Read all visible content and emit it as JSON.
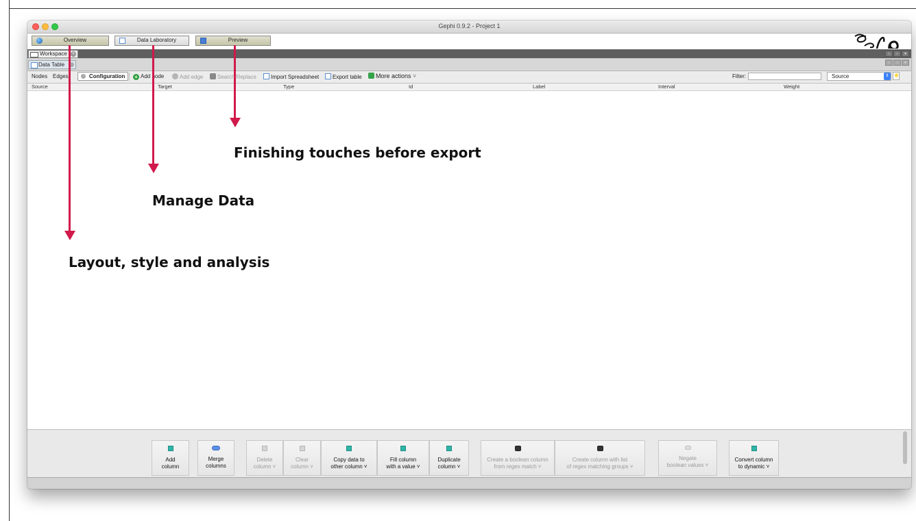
{
  "window": {
    "title": "Gephi 0.9.2 - Project 1"
  },
  "main_tabs": [
    {
      "label": "Overview",
      "icon": "globe-icon"
    },
    {
      "label": "Data Laboratory",
      "icon": "table-grid-icon"
    },
    {
      "label": "Preview",
      "icon": "monitor-icon"
    }
  ],
  "workspace": {
    "tab_label": "Workspace 1"
  },
  "data_table": {
    "tab_label": "Data Table"
  },
  "toolbar": {
    "nodes": "Nodes",
    "edges": "Edges",
    "configuration": "Configuration",
    "add_node": "Add node",
    "add_edge": "Add edge",
    "search_replace": "Search/Replace",
    "import_spreadsheet": "Import Spreadsheet",
    "export_table": "Export table",
    "more_actions": "More actions",
    "filter_label": "Filter:",
    "filter_value": "",
    "source_select": "Source"
  },
  "columns": [
    "Source",
    "Target",
    "Type",
    "Id",
    "Label",
    "Interval",
    "Weight"
  ],
  "actions": [
    {
      "line1": "Add",
      "line2": "column",
      "enabled": true
    },
    {
      "line1": "Merge",
      "line2": "columns",
      "enabled": true
    },
    {
      "line1": "Delete",
      "line2": "column ˅",
      "enabled": false
    },
    {
      "line1": "Clear",
      "line2": "column ˅",
      "enabled": false
    },
    {
      "line1": "Copy data to",
      "line2": "other column ˅",
      "enabled": true
    },
    {
      "line1": "Fill column",
      "line2": "with a value ˅",
      "enabled": true
    },
    {
      "line1": "Duplicate",
      "line2": "column ˅",
      "enabled": true
    },
    {
      "line1": "Create a boolean column",
      "line2": "from regex match ˅",
      "enabled": false
    },
    {
      "line1": "Create column with list",
      "line2": "of regex matching groups ˅",
      "enabled": false
    },
    {
      "line1": "Negate",
      "line2": "boolean values ˅",
      "enabled": false
    },
    {
      "line1": "Convert column",
      "line2": "to dynamic ˅",
      "enabled": true
    }
  ],
  "annotations": [
    {
      "text": "Finishing touches before export"
    },
    {
      "text": "Manage Data"
    },
    {
      "text": "Layout, style and analysis"
    }
  ],
  "colors": {
    "annotation_arrow": "#d1194b",
    "add_node_green": "#2e9e3f"
  }
}
